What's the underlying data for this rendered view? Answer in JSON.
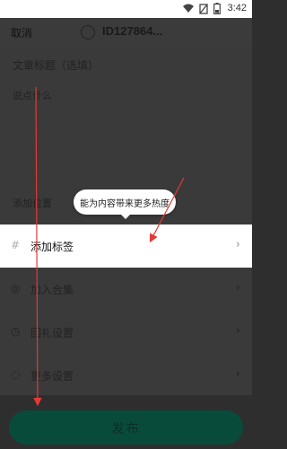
{
  "status_bar": {
    "time": "3:42"
  },
  "header": {
    "cancel_label": "取消",
    "account_id": "ID127864..."
  },
  "form": {
    "title_placeholder": "文章标题（选填）",
    "desc_placeholder": "说点什么",
    "location_label": "添加位置"
  },
  "tooltip": {
    "text": "能为内容带来更多热度"
  },
  "rows": [
    {
      "icon": "#",
      "label": "添加标签"
    },
    {
      "icon": "◎",
      "label": "加入合集"
    },
    {
      "icon": "◷",
      "label": "回礼设置"
    },
    {
      "icon": "◌",
      "label": "更多设置"
    }
  ],
  "publish": {
    "label": "发布"
  },
  "colors": {
    "accent": "#094b3b",
    "arrow": "#e53935"
  }
}
